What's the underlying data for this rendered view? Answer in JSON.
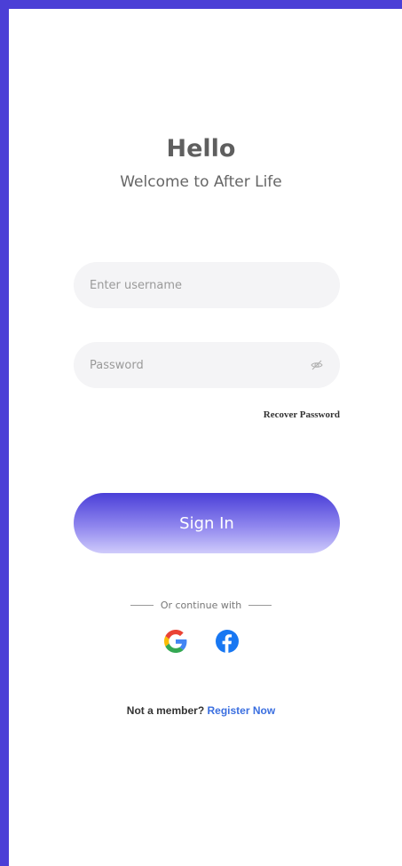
{
  "header": {
    "title": "Hello",
    "subtitle": "Welcome to After Life"
  },
  "form": {
    "username_placeholder": "Enter username",
    "username_value": "",
    "password_placeholder": "Password",
    "password_value": "",
    "recover_label": "Recover Password",
    "signin_label": "Sign In"
  },
  "social": {
    "divider_text": "Or continue with",
    "providers": [
      {
        "name": "Google",
        "icon": "google-icon"
      },
      {
        "name": "Facebook",
        "icon": "facebook-icon"
      }
    ]
  },
  "footer": {
    "question": "Not a  member?",
    "register_label": "Register Now"
  },
  "colors": {
    "frame": "#4b3fd6",
    "button_top": "#4a3fd8",
    "button_bottom": "#cfcbfb",
    "link": "#3b6fe0"
  }
}
